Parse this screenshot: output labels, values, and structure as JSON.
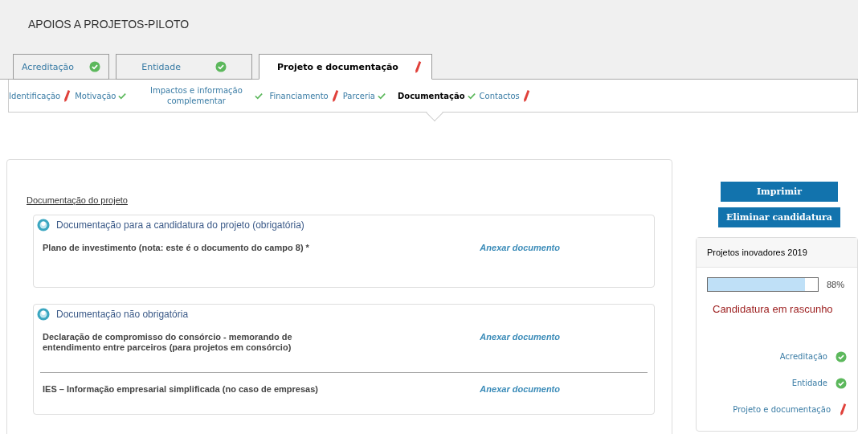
{
  "page_title": "APOIOS A PROJETOS-PILOTO",
  "tabs": [
    {
      "label": "Acreditação",
      "selected": false,
      "complete": true
    },
    {
      "label": "Entidade",
      "selected": false,
      "complete": true
    },
    {
      "label": "Projeto e documentação",
      "selected": true,
      "complete": false
    }
  ],
  "subtabs": [
    {
      "label": "Identificação",
      "selected": false,
      "complete": false
    },
    {
      "label": "Motivação",
      "selected": false,
      "complete": true
    },
    {
      "label": "Impactos e informação complementar",
      "selected": false,
      "complete": true
    },
    {
      "label": "Financiamento",
      "selected": false,
      "complete": false
    },
    {
      "label": "Parceria",
      "selected": false,
      "complete": true
    },
    {
      "label": "Documentação",
      "selected": true,
      "complete": true
    },
    {
      "label": "Contactos",
      "selected": false,
      "complete": false
    }
  ],
  "section_title": "Documentação do projeto",
  "groups": [
    {
      "title": "Documentação para a candidatura do projeto (obrigatória)",
      "documents": [
        {
          "name": "Plano de investimento (nota: este é o documento do campo 8) *",
          "action": "Anexar documento"
        }
      ]
    },
    {
      "title": "Documentação não obrigatória",
      "documents": [
        {
          "name": "Declaração de compromisso do consórcio - memorando de entendimento entre parceiros (para projetos em consórcio)",
          "action": "Anexar documento"
        },
        {
          "name": "IES – Informação empresarial simplificada (no caso de empresas)",
          "action": "Anexar documento"
        }
      ]
    }
  ],
  "buttons": [
    "Imprimir",
    "Eliminar candidatura"
  ],
  "summary": {
    "title": "Projetos inovadores 2019",
    "level": 0.88,
    "percent": "88%",
    "status": "Candidatura em rascunho",
    "steps": [
      {
        "label": "Acreditação",
        "complete": true
      },
      {
        "label": "Entidade",
        "complete": true
      },
      {
        "label": "Projeto e documentação",
        "complete": false
      }
    ]
  }
}
